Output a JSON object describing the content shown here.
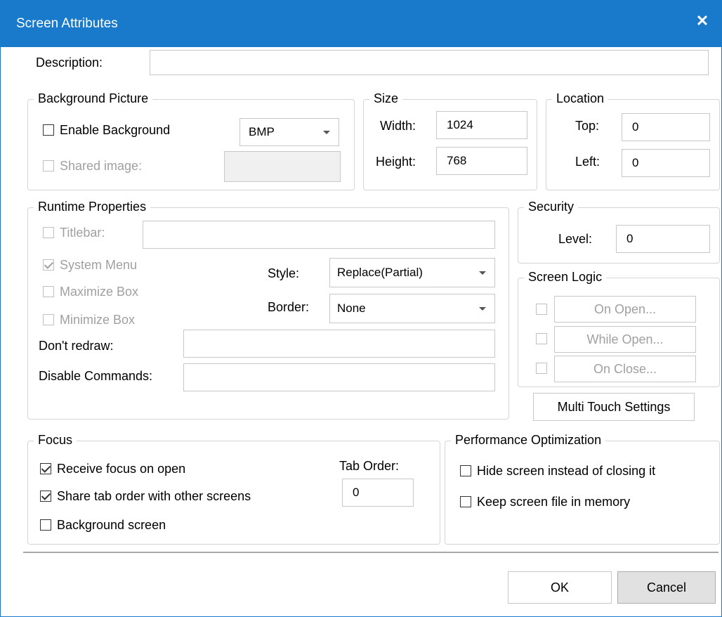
{
  "window": {
    "title": "Screen Attributes",
    "close_glyph": "✕"
  },
  "description": {
    "label": "Description:",
    "value": ""
  },
  "background_picture": {
    "legend": "Background Picture",
    "enable_label": "Enable Background",
    "enable_checked": false,
    "format_value": "BMP",
    "shared_label": "Shared image:",
    "shared_checked": false,
    "shared_value": ""
  },
  "size": {
    "legend": "Size",
    "width_label": "Width:",
    "width_value": "1024",
    "height_label": "Height:",
    "height_value": "768"
  },
  "location": {
    "legend": "Location",
    "top_label": "Top:",
    "top_value": "0",
    "left_label": "Left:",
    "left_value": "0"
  },
  "runtime": {
    "legend": "Runtime Properties",
    "titlebar_label": "Titlebar:",
    "titlebar_value": "",
    "system_menu_label": "System Menu",
    "system_menu_checked": true,
    "maximize_label": "Maximize Box",
    "minimize_label": "Minimize Box",
    "style_label": "Style:",
    "style_value": "Replace(Partial)",
    "border_label": "Border:",
    "border_value": "None",
    "dont_redraw_label": "Don't redraw:",
    "dont_redraw_value": "",
    "disable_commands_label": "Disable Commands:",
    "disable_commands_value": ""
  },
  "security": {
    "legend": "Security",
    "level_label": "Level:",
    "level_value": "0"
  },
  "screen_logic": {
    "legend": "Screen Logic",
    "on_open": "On Open...",
    "while_open": "While Open...",
    "on_close": "On Close..."
  },
  "multi_touch_label": "Multi Touch Settings",
  "focus": {
    "legend": "Focus",
    "receive_label": "Receive focus on open",
    "receive_checked": true,
    "share_label": "Share tab order with other screens",
    "share_checked": true,
    "background_label": "Background screen",
    "background_checked": false,
    "tab_order_label": "Tab Order:",
    "tab_order_value": "0"
  },
  "performance": {
    "legend": "Performance Optimization",
    "hide_label": "Hide screen instead of closing it",
    "keep_label": "Keep screen file in memory"
  },
  "buttons": {
    "ok": "OK",
    "cancel": "Cancel"
  },
  "colors": {
    "title_bar": "#1979ca",
    "disabled_text": "#a0a0a0"
  }
}
